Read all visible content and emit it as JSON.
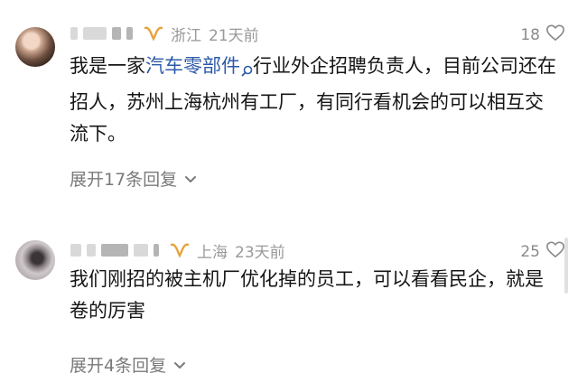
{
  "comments": [
    {
      "location": "浙江",
      "time": "21天前",
      "likes": "18",
      "text_before": "我是一家",
      "link_text": "汽车零部件",
      "text_after": "行业外企招聘负责人，目前公司还在招人，苏州上海杭州有工厂，有同行看机会的可以相互交流下。",
      "replies_label": "展开17条回复"
    },
    {
      "location": "上海",
      "time": "23天前",
      "likes": "25",
      "text": "我们刚招的被主机厂优化掉的员工，可以看看民企，就是卷的厉害",
      "replies_label": "展开4条回复"
    }
  ],
  "colors": {
    "link": "#2c5aa8",
    "meta": "#999999",
    "badge": "#e8a33b"
  },
  "icons": {
    "badge": "gold-v-badge-icon",
    "like": "heart-outline-icon",
    "search": "search-icon",
    "expand": "chevron-down-icon"
  }
}
